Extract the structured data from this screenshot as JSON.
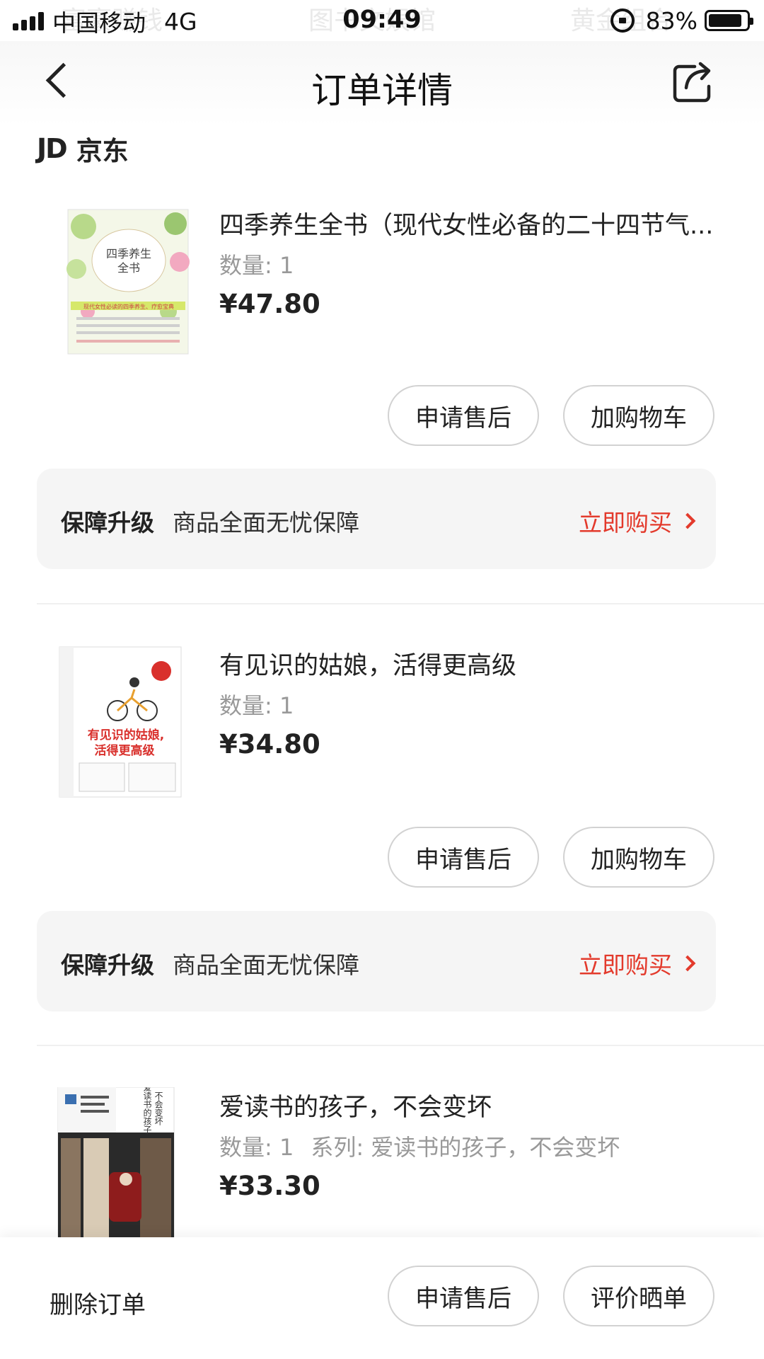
{
  "status_bar": {
    "carrier": "中国移动",
    "network": "4G",
    "time": "09:49",
    "battery": "83%",
    "battery_level": 0.83,
    "ghost_texts": [
      "富豪赚钱",
      "图书文娱馆",
      "黄金组合"
    ]
  },
  "nav": {
    "title": "订单详情",
    "back_icon": "chevron-left-icon",
    "share_icon": "share-icon"
  },
  "shop": {
    "logo": "JD",
    "name": "京东"
  },
  "products": [
    {
      "title": "四季养生全书（现代女性必备的二十四节气...",
      "qty": "数量: 1",
      "series": "",
      "price": "¥47.80",
      "cover_title": "四季养生\n全书",
      "cover_subtitle": "现代女性必读的四季养生、疗愈宝典",
      "after_sales": "申请售后",
      "add_cart": "加购物车"
    },
    {
      "title": "有见识的姑娘，活得更高级",
      "qty": "数量: 1",
      "series": "",
      "price": "¥34.80",
      "cover_title": "有见识的姑娘，\n活得更高级",
      "after_sales": "申请售后",
      "add_cart": "加购物车"
    },
    {
      "title": "爱读书的孩子，不会变坏",
      "qty": "数量: 1",
      "series": "系列: 爱读书的孩子，不会变坏",
      "price": "¥33.30",
      "cover_title": "爱读书的孩子\n不会变坏"
    }
  ],
  "guarantee": {
    "title": "保障升级",
    "desc": "商品全面无忧保障",
    "link": "立即购买"
  },
  "bottom": {
    "delete": "删除订单",
    "after_sales": "申请售后",
    "review": "评价晒单"
  },
  "colors": {
    "accent": "#e33a2c",
    "guarantee_bg": "#f5f5f5"
  }
}
